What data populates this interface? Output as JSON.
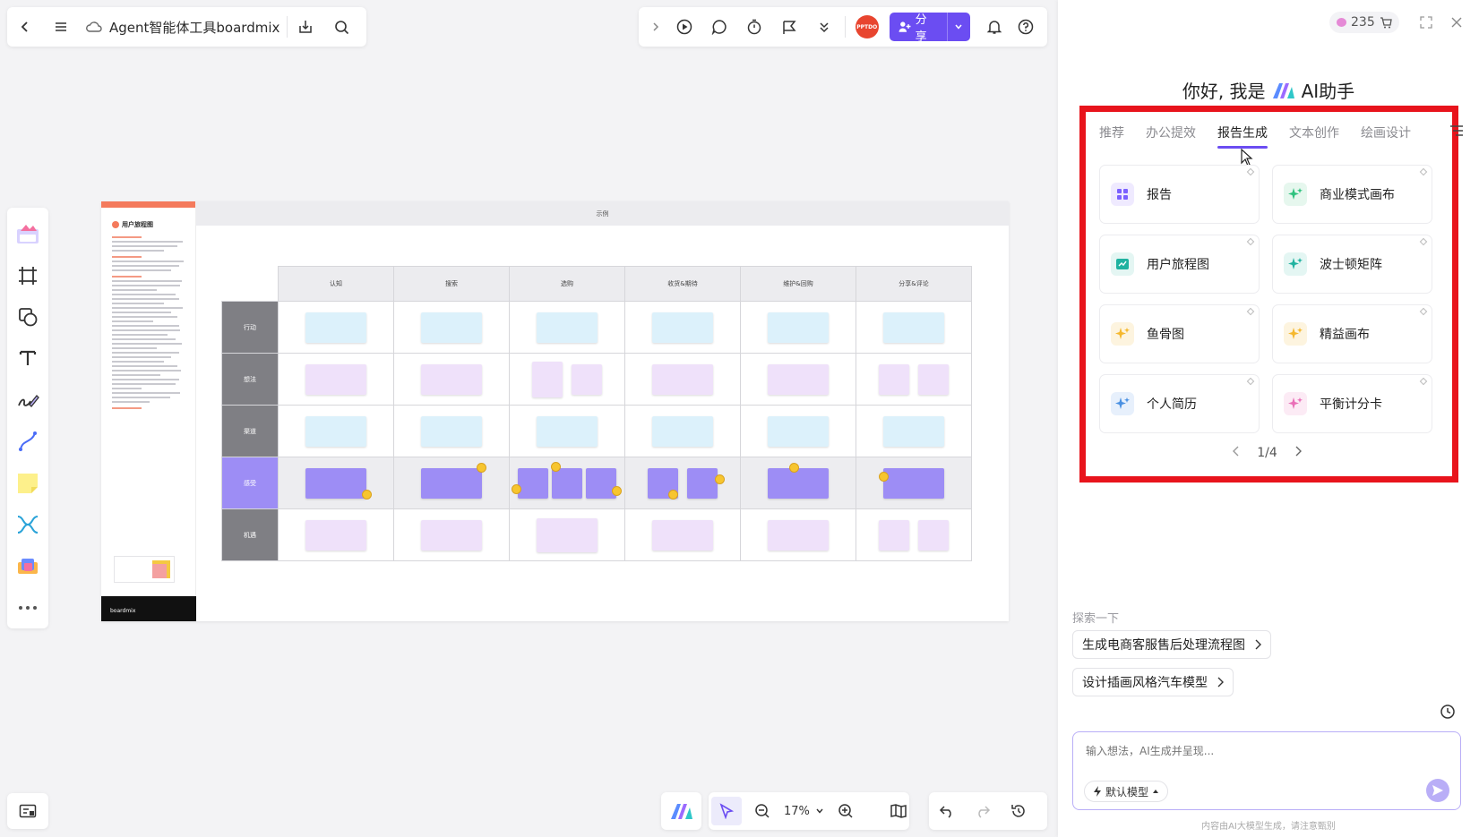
{
  "topbar": {
    "doc_title": "Agent智能体工具boardmix"
  },
  "header_right": {
    "avatar_text": "PPTDO",
    "share_label": "分享"
  },
  "frame": {
    "header": "示例",
    "doc_heading": "用户旅程图",
    "footer_brand": "boardmix",
    "columns": [
      "认知",
      "搜索",
      "选购",
      "收货&期待",
      "维护&回购",
      "分享&评论"
    ],
    "rows": [
      "行动",
      "想法",
      "渠道",
      "感受",
      "机遇"
    ]
  },
  "bottombar": {
    "zoom": "17%"
  },
  "ai_panel": {
    "credits": "235",
    "greeting_prefix": "你好, 我是",
    "greeting_suffix": "AI助手",
    "tabs": [
      "推荐",
      "办公提效",
      "报告生成",
      "文本创作",
      "绘画设计"
    ],
    "active_tab": "报告生成",
    "tiles": [
      {
        "label": "报告",
        "icon": "grid-icon",
        "color": "#7b61ff"
      },
      {
        "label": "商业模式画布",
        "icon": "sparkle-icon",
        "color": "#2ec27e"
      },
      {
        "label": "用户旅程图",
        "icon": "journey-icon",
        "color": "#20b2a0"
      },
      {
        "label": "波士顿矩阵",
        "icon": "sparkle-icon",
        "color": "#20b2a0"
      },
      {
        "label": "鱼骨图",
        "icon": "sparkle-icon",
        "color": "#f5b82e"
      },
      {
        "label": "精益画布",
        "icon": "sparkle-icon",
        "color": "#f5b82e"
      },
      {
        "label": "个人简历",
        "icon": "sparkle-icon",
        "color": "#4a90e2"
      },
      {
        "label": "平衡计分卡",
        "icon": "sparkle-icon",
        "color": "#e96fb7"
      }
    ],
    "pager": "1/4",
    "explore_label": "探索一下",
    "suggestions": [
      "生成电商客服售后处理流程图",
      "设计插画风格汽车模型"
    ],
    "input_placeholder": "输入想法，AI生成并呈现...",
    "model_label": "默认模型",
    "disclaimer": "内容由AI大模型生成，请注意甄别"
  }
}
